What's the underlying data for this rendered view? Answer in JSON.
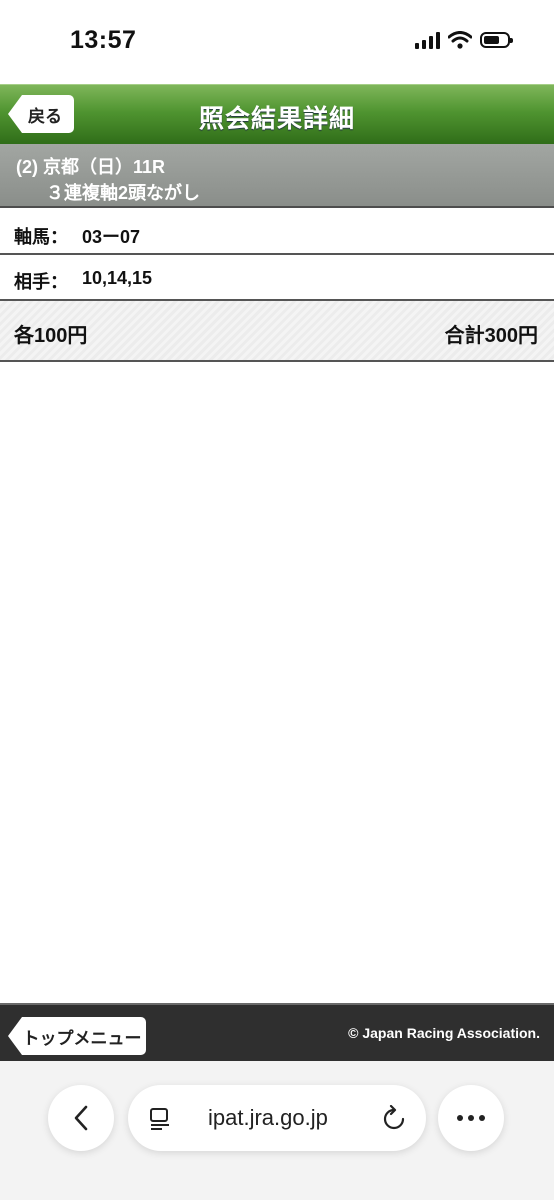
{
  "status_bar": {
    "time": "13:57"
  },
  "header": {
    "back_label": "戻る",
    "title": "照会結果詳細"
  },
  "race": {
    "line1": "(2) 京都（日）11R",
    "line2": "３連複軸2頭ながし"
  },
  "axis": {
    "label": "軸馬：",
    "value": "03ー07"
  },
  "partner": {
    "label": "相手：",
    "value": "10,14,15"
  },
  "amount": {
    "each": "各100円",
    "total": "合計300円"
  },
  "footer": {
    "top_menu_label": "トップメニュー",
    "copyright": "© Japan Racing Association."
  },
  "browser": {
    "url": "ipat.jra.go.jp"
  }
}
